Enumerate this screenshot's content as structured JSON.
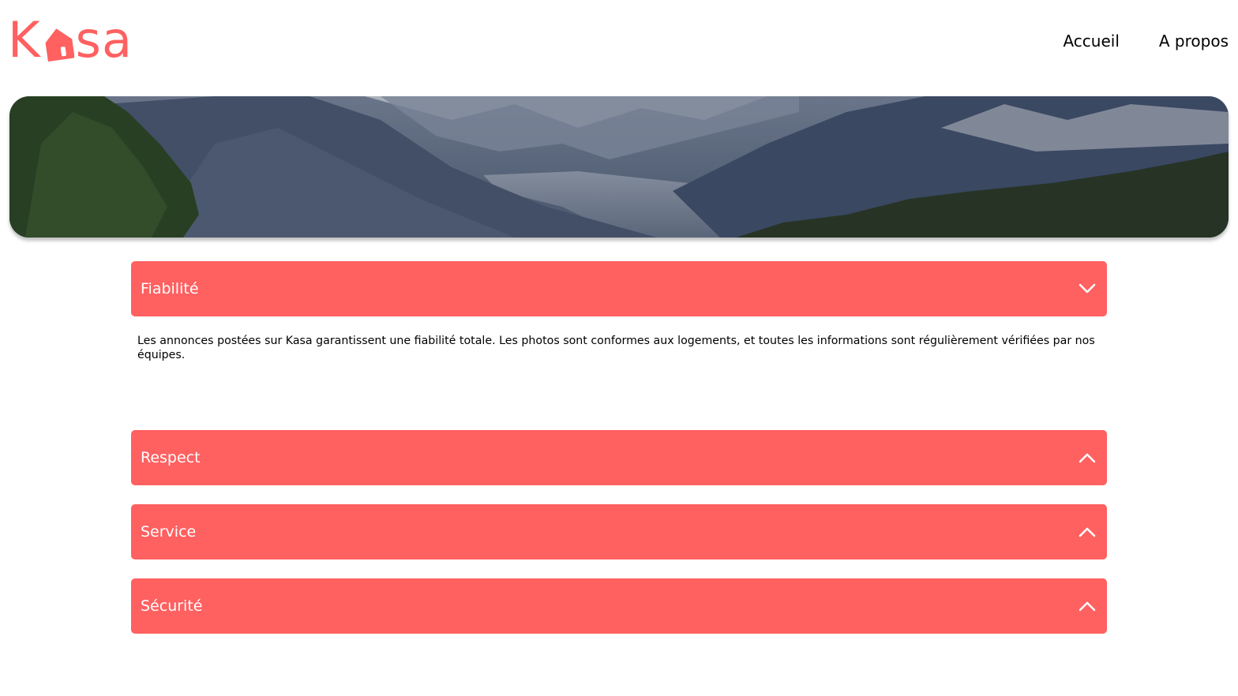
{
  "header": {
    "logo": {
      "prefix": "K",
      "suffix": "sa",
      "icon": "house-icon",
      "color": "#FF6060"
    },
    "nav": [
      {
        "label": "Accueil"
      },
      {
        "label": "A propos"
      }
    ]
  },
  "banner": {
    "image": "mountain-landscape"
  },
  "accordions": [
    {
      "title": "Fiabilité",
      "expanded": true,
      "icon": "chevron-down-icon",
      "content": "Les annonces postées sur Kasa garantissent une fiabilité totale. Les photos sont conformes aux logements, et toutes les informations sont régulièrement vérifiées par nos équipes."
    },
    {
      "title": "Respect",
      "expanded": false,
      "icon": "chevron-up-icon"
    },
    {
      "title": "Service",
      "expanded": false,
      "icon": "chevron-up-icon"
    },
    {
      "title": "Sécurité",
      "expanded": false,
      "icon": "chevron-up-icon"
    }
  ],
  "colors": {
    "accent": "#FF6060",
    "text_on_accent": "#FFFFFF"
  }
}
